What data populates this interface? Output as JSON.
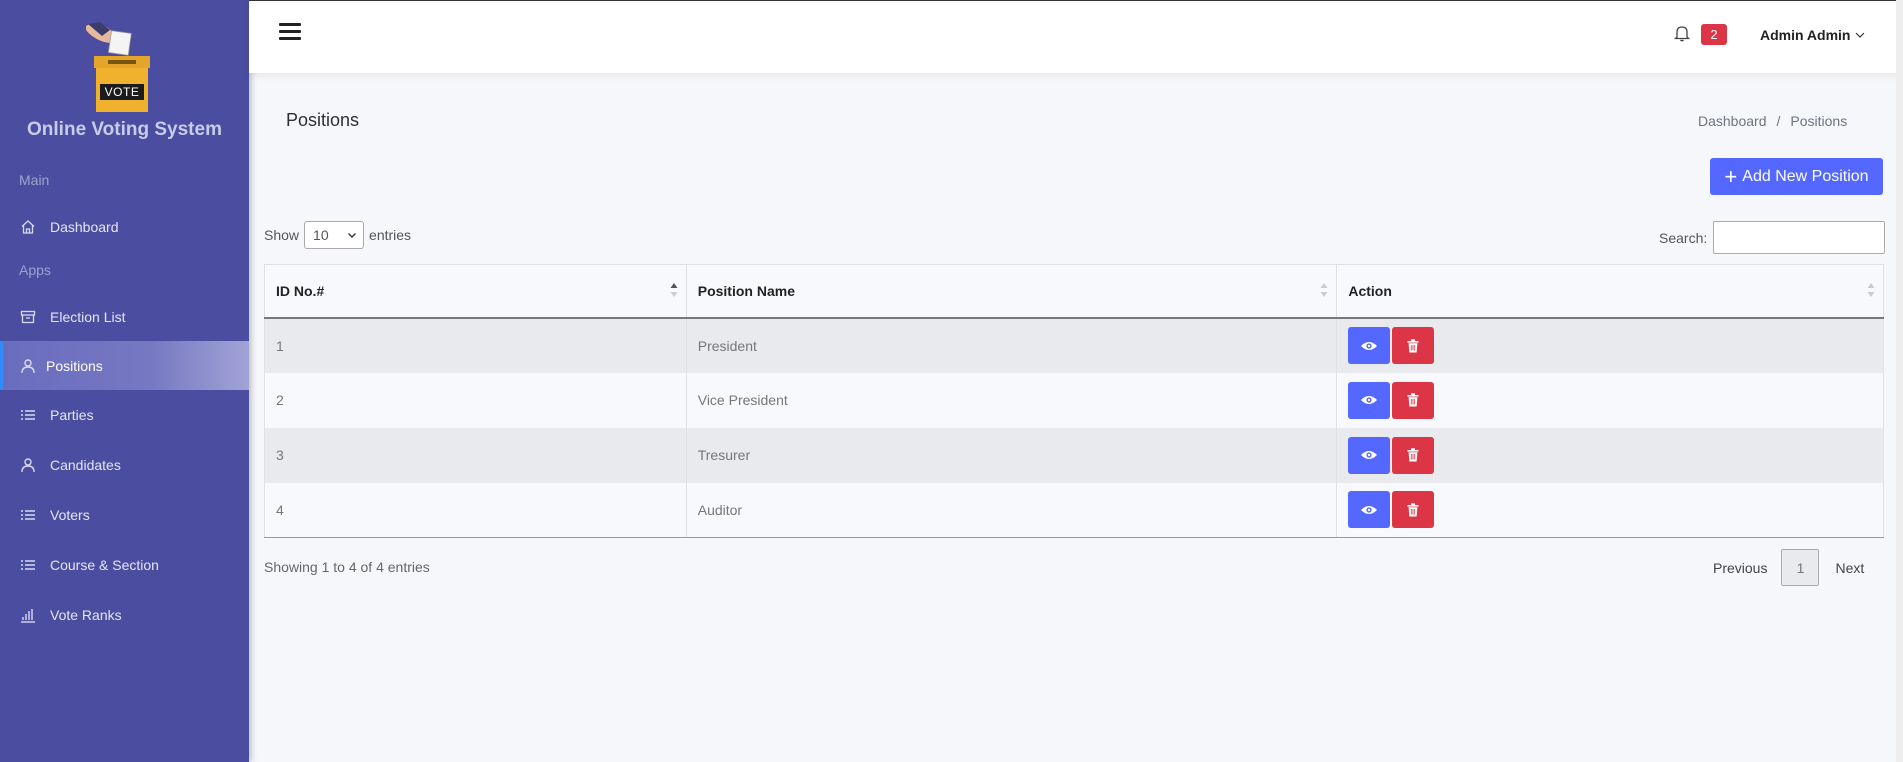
{
  "app": {
    "title": "Online Voting System",
    "logo_text": "VOTE"
  },
  "sidebar": {
    "sections": [
      {
        "label": "Main"
      },
      {
        "label": "Apps"
      }
    ],
    "items": [
      {
        "label": "Dashboard",
        "icon": "home-icon",
        "active": false
      },
      {
        "label": "Election List",
        "icon": "archive-icon",
        "active": false
      },
      {
        "label": "Positions",
        "icon": "user-icon",
        "active": true
      },
      {
        "label": "Parties",
        "icon": "list-icon",
        "active": false
      },
      {
        "label": "Candidates",
        "icon": "user-icon",
        "active": false
      },
      {
        "label": "Voters",
        "icon": "list-icon",
        "active": false
      },
      {
        "label": "Course & Section",
        "icon": "list-icon",
        "active": false
      },
      {
        "label": "Vote Ranks",
        "icon": "bar-chart-icon",
        "active": false
      }
    ]
  },
  "header": {
    "notification_count": "2",
    "user_name": "Admin Admin"
  },
  "page": {
    "title": "Positions",
    "breadcrumb": [
      "Dashboard",
      "/",
      "Positions"
    ],
    "add_button_label": "Add New Position"
  },
  "table_controls": {
    "show_label": "Show",
    "entries_value": "10",
    "entries_label": "entries",
    "search_label": "Search:",
    "search_value": ""
  },
  "table": {
    "columns": [
      "ID No.#",
      "Position Name",
      "Action"
    ],
    "rows": [
      {
        "id": "1",
        "name": "President"
      },
      {
        "id": "2",
        "name": "Vice President"
      },
      {
        "id": "3",
        "name": "Tresurer"
      },
      {
        "id": "4",
        "name": "Auditor"
      }
    ]
  },
  "footer": {
    "info": "Showing 1 to 4 of 4 entries",
    "previous": "Previous",
    "page": "1",
    "next": "Next"
  },
  "colors": {
    "sidebar_bg": "#4b4ea0",
    "primary": "#5468ff",
    "danger": "#dc3545"
  }
}
